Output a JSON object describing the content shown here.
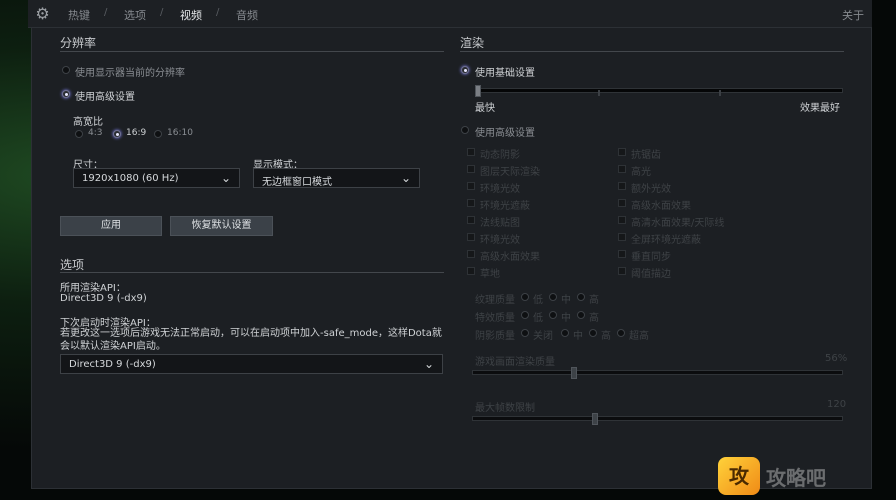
{
  "topbar": {
    "tabs": [
      {
        "label": "热键",
        "active": false
      },
      {
        "label": "选项",
        "active": false
      },
      {
        "label": "视频",
        "active": true
      },
      {
        "label": "音频",
        "active": false
      }
    ],
    "separator": "/",
    "close_label": "关于"
  },
  "resolution": {
    "title": "分辨率",
    "use_current_label": "使用显示器当前的分辨率",
    "use_advanced_label": "使用高级设置",
    "aspect_label": "高宽比",
    "aspect_options": [
      {
        "label": "4:3",
        "selected": false
      },
      {
        "label": "16:9",
        "selected": true
      },
      {
        "label": "16:10",
        "selected": false
      }
    ],
    "size_label": "尺寸：",
    "size_value": "1920x1080 (60 Hz)",
    "display_mode_label": "显示模式：",
    "display_mode_value": "无边框窗口模式",
    "apply_label": "应用",
    "reset_label": "恢复默认设置"
  },
  "options": {
    "title": "选项",
    "render_api_label": "所用渲染API：",
    "render_api_value": "Direct3D 9 (-dx9)",
    "next_api_label": "下次启动时渲染API：",
    "note": "若更改这一选项后游戏无法正常启动，可以在启动项中加入-safe_mode，这样Dota就会以默认渲染API启动。",
    "api_select_value": "Direct3D 9 (-dx9)"
  },
  "rendering": {
    "title": "渲染",
    "use_basic_label": "使用基础设置",
    "slider_min_label": "最快",
    "slider_max_label": "效果最好",
    "slider_level": 0,
    "use_advanced_label": "使用高级设置",
    "checkboxes_left": [
      "动态阴影",
      "图层天际渲染",
      "环境光效",
      "环境光遮蔽",
      "法线贴图",
      "环境光效",
      "高级水面效果",
      "草地"
    ],
    "checkboxes_right": [
      "抗锯齿",
      "高光",
      "额外光效",
      "高级水面效果",
      "高清水面效果/天际线",
      "全屏环境光遮蔽",
      "垂直同步",
      "阈值描边"
    ],
    "quality_rows": [
      {
        "label": "纹理质量",
        "options": [
          "低",
          "中",
          "高"
        ]
      },
      {
        "label": "特效质量",
        "options": [
          "低",
          "中",
          "高"
        ]
      },
      {
        "label": "阴影质量",
        "options": [
          "关闭",
          "中",
          "高",
          "超高"
        ]
      }
    ],
    "render_quality_label": "游戏画面渲染质量",
    "render_quality_value": "56%",
    "render_quality_level": 0.27,
    "fps_label": "最大帧数限制",
    "fps_value": "120",
    "fps_level": 0.33
  },
  "watermark": {
    "text": "攻略吧",
    "logo_text": "攻"
  },
  "colors": {
    "accent_glow": "#8a8cff",
    "panel_bg": "#1c1f23",
    "logo_orange": "#f08a16"
  }
}
